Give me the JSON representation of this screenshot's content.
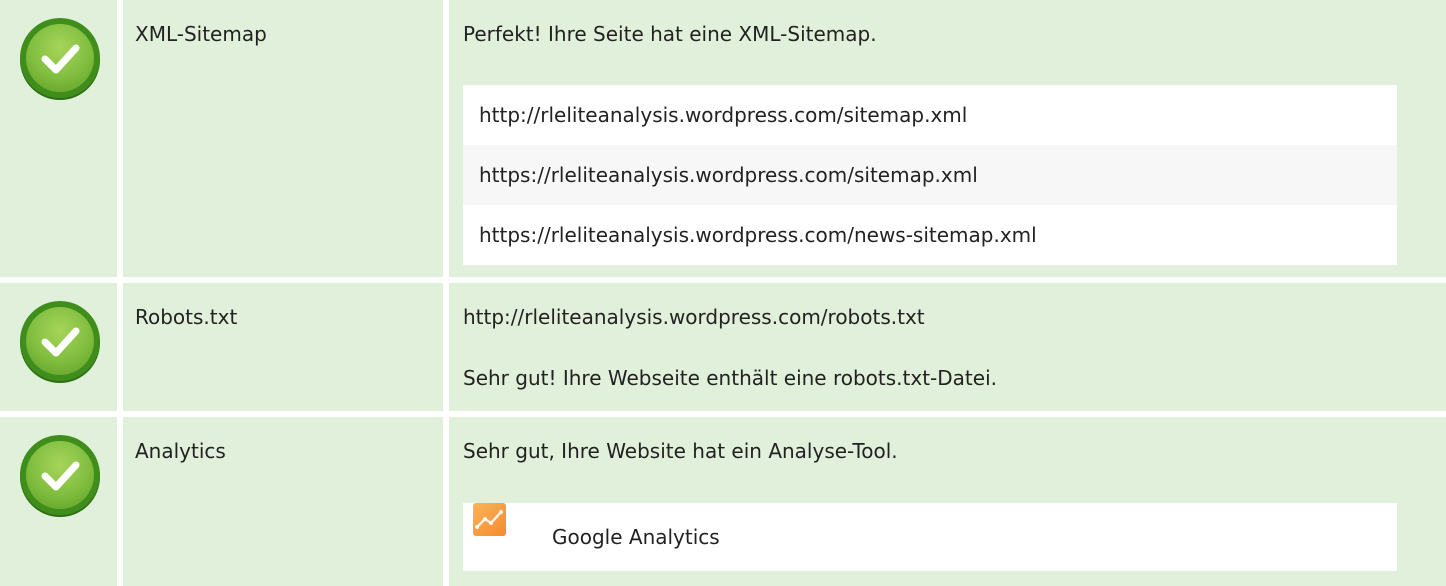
{
  "rows": [
    {
      "label": "XML-Sitemap",
      "status": "Perfekt! Ihre Seite hat eine XML-Sitemap.",
      "urls": [
        "http://rleliteanalysis.wordpress.com/sitemap.xml",
        "https://rleliteanalysis.wordpress.com/sitemap.xml",
        "https://rleliteanalysis.wordpress.com/news-sitemap.xml"
      ]
    },
    {
      "label": "Robots.txt",
      "url": "http://rleliteanalysis.wordpress.com/robots.txt",
      "status": "Sehr gut! Ihre Webseite enthält eine robots.txt-Datei."
    },
    {
      "label": "Analytics",
      "status": "Sehr gut, Ihre Website hat ein Analyse-Tool.",
      "tools": [
        "Google Analytics"
      ]
    }
  ],
  "icons": {
    "status": "check-circle-icon",
    "tool": "google-analytics-icon"
  },
  "colors": {
    "row_bg": "#e1f0da",
    "check_green": "#80bd3e",
    "check_dark": "#3f8e1c",
    "analytics_orange": "#f58a2b"
  }
}
